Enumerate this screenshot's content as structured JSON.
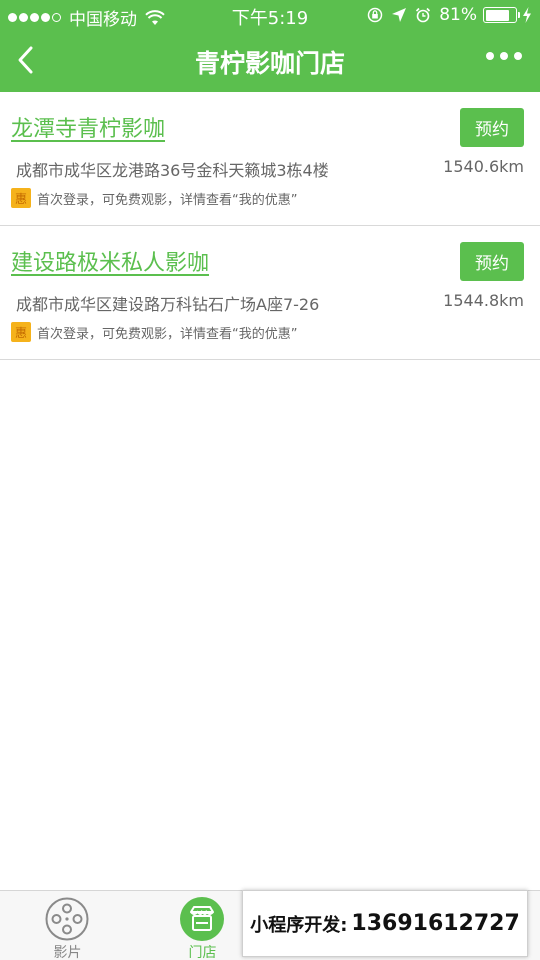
{
  "status_bar": {
    "carrier": "中国移动",
    "time": "下午5:19",
    "battery": "81%",
    "battery_level": 0.81
  },
  "nav": {
    "title": "青柠影咖门店"
  },
  "stores": [
    {
      "name": "龙潭寺青柠影咖",
      "book_label": "预约",
      "address": "成都市成华区龙港路36号金科天籁城3栋4楼",
      "distance": "1540.6km",
      "promo_badge": "惠",
      "promo_text": "首次登录，可免费观影，详情查看“我的优惠”"
    },
    {
      "name": "建设路极米私人影咖",
      "book_label": "预约",
      "address": "成都市成华区建设路万科钻石广场A座7-26",
      "distance": "1544.8km",
      "promo_badge": "惠",
      "promo_text": "首次登录，可免费观影，详情查看“我的优惠”"
    }
  ],
  "tabs": [
    {
      "label": "影片",
      "icon": "film-reel-icon"
    },
    {
      "label": "门店",
      "icon": "store-icon"
    }
  ],
  "overlay": {
    "label": "小程序开发:",
    "phone": "13691612727"
  },
  "colors": {
    "brand": "#5bbf4e",
    "promo_badge": "#f5b21b"
  }
}
